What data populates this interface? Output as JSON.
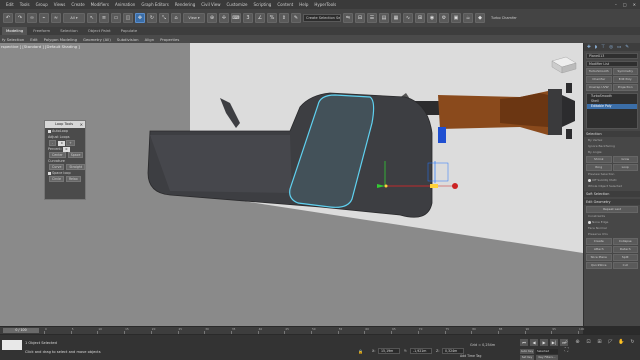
{
  "menubar": {
    "items": [
      "Edit",
      "Tools",
      "Group",
      "Views",
      "Create",
      "Modifiers",
      "Animation",
      "Graph Editors",
      "Rendering",
      "Civil View",
      "Customize",
      "Scripting",
      "Content",
      "Help",
      "HyperTools"
    ]
  },
  "toolbar": {
    "view_dropdown": "View",
    "named_selection": "Create Selection Se",
    "turbochamfer": "Turbo Chamfer"
  },
  "ribbon": {
    "tabs": [
      "Modeling",
      "Freeform",
      "Selection",
      "Object Paint",
      "Populate"
    ],
    "active_tab": "Modeling",
    "sub_items": [
      "fy Selection",
      "Edit",
      "Polygon Modeling",
      "Geometry (All)",
      "Subdivision",
      "Align",
      "Properties"
    ]
  },
  "viewport": {
    "label": "rspective ] [Standard ] [Default Shading ]"
  },
  "loop_tools": {
    "title": "Loop Tools",
    "autoloop_label": "AutoLoop",
    "adjust_loops_label": "Adjust Loops",
    "minus": "-",
    "value": "0",
    "plus": "+",
    "percent_label": "Percent:",
    "percent_value": "0",
    "center_btn": "Center",
    "space_btn": "Space",
    "curvature_label": "Curvature",
    "curve_btn": "Curve",
    "straight_btn": "Straight",
    "space_loop_label": "Space loop",
    "circle_btn": "Circle",
    "relax_btn": "Relax"
  },
  "command_panel": {
    "object_name": "Plane013",
    "modifier_list": "Modifier List",
    "buttons_row1": [
      "TurboSmooth",
      "Symmetry"
    ],
    "buttons_row2": [
      "Chamfer",
      "Edit Poly"
    ],
    "buttons_row3": [
      "Unwrap UVW",
      "Projection"
    ],
    "stack": [
      "TurboSmooth",
      "Shell",
      "Editable Poly"
    ],
    "stack_selected": "Editable Poly",
    "selection_header": "Selection",
    "by_vertex": "By Vertex",
    "ignore_backfacing": "Ignore Backfacing",
    "by_angle": "By Angle:",
    "shrink": "Shrink",
    "grow": "Grow",
    "ring": "Ring",
    "loop": "Loop",
    "preview_selection": "Preview Selection",
    "off_label": "Off",
    "subobj": "SubObj",
    "multi": "Multi",
    "whole_selected": "Whole Object Selected",
    "soft_selection": "Soft Selection",
    "edit_geometry": "Edit Geometry",
    "repeat_last": "Repeat Last",
    "constraints": "Constraints",
    "none": "None",
    "edge": "Edge",
    "face": "Face",
    "normal": "Normal",
    "preserve_uvs": "Preserve UVs",
    "create": "Create",
    "collapse": "Collapse",
    "attach": "Attach",
    "detach": "Detach",
    "slice_plane": "Slice Plane",
    "split": "Split",
    "quickslice": "QuickSlice",
    "cut": "Cut"
  },
  "timeline": {
    "slider": "0 / 100",
    "ticks": [
      "0",
      "5",
      "10",
      "15",
      "20",
      "25",
      "30",
      "35",
      "40",
      "45",
      "50",
      "55",
      "60",
      "65",
      "70",
      "75",
      "80",
      "85",
      "90",
      "95",
      "100"
    ]
  },
  "status": {
    "line1": "1 Object Selected",
    "line2": "Click and drag to select and move objects",
    "x_label": "X:",
    "x_value": "15,19m",
    "y_label": "Y:",
    "y_value": "-1,921m",
    "z_label": "Z:",
    "z_value": "0,324m",
    "grid": "Grid = 0,254m",
    "add_time_tag": "Add Time Tag",
    "auto_key": "Auto Key",
    "selected": "Selected",
    "set_key": "Set Key",
    "key_filters": "Key Filters..."
  },
  "colors": {
    "accent": "#3b6ea8",
    "viewport_bg": "#8a8a8a",
    "plane": "#dcdcdc",
    "mesh": "#3d3e42",
    "wood": "#8a4a1c",
    "selection": "#5fd1f0"
  }
}
